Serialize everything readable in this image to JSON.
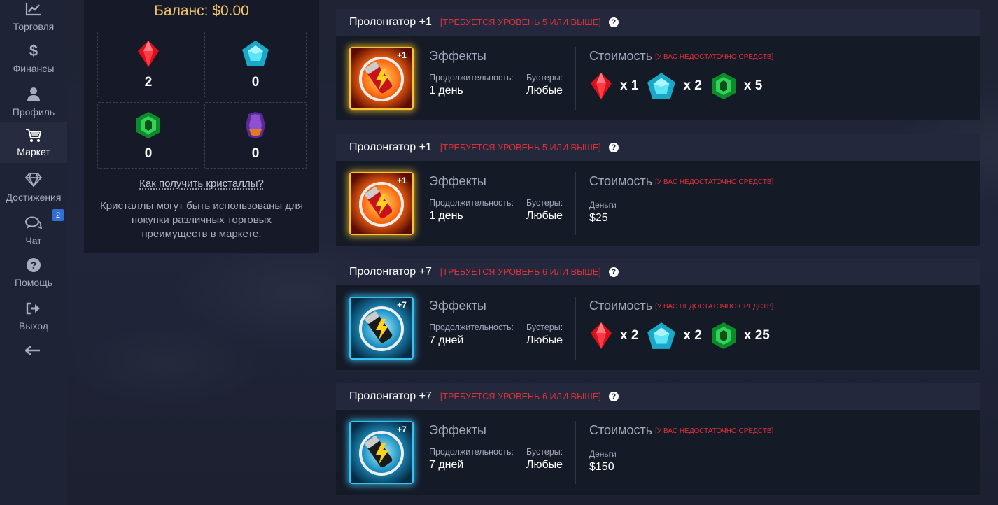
{
  "nav": {
    "items": [
      {
        "label": "Торговля",
        "icon": "chart-icon"
      },
      {
        "label": "Финансы",
        "icon": "dollar-icon"
      },
      {
        "label": "Профиль",
        "icon": "user-icon"
      },
      {
        "label": "Маркет",
        "icon": "cart-icon"
      },
      {
        "label": "Достижения",
        "icon": "diamond-icon"
      },
      {
        "label": "Чат",
        "icon": "chat-icon"
      },
      {
        "label": "Помощь",
        "icon": "help-icon"
      },
      {
        "label": "Выход",
        "icon": "logout-icon"
      }
    ],
    "chat_badge": "2",
    "active": "Маркет"
  },
  "balance": {
    "title": "Баланс: $0.00",
    "crystals": [
      {
        "name": "red",
        "count": "2"
      },
      {
        "name": "blue",
        "count": "0"
      },
      {
        "name": "green",
        "count": "0"
      },
      {
        "name": "purple",
        "count": "0"
      }
    ],
    "how_link": "Как получить кристаллы?",
    "description": "Кристаллы могут быть использованы для покупки различных торговых преимуществ в маркете."
  },
  "market": {
    "labels": {
      "effects": "Эффекты",
      "duration": "Продолжительность:",
      "boosters": "Бустеры:",
      "cost": "Стоимость",
      "insufficient": "[У ВАС НЕДОСТАТОЧНО СРЕДСТВ]",
      "money": "Деньги"
    },
    "items": [
      {
        "title": "Пролонгатор +1",
        "requirement": "[ТРЕБУЕТСЯ УРОВЕНЬ 5 ИЛИ ВЫШЕ]",
        "duration": "1 день",
        "boosters": "Любые",
        "image": "prolongator-plus-1",
        "price": {
          "red": "x 1",
          "blue": "x 2",
          "green": "x 5"
        }
      },
      {
        "title": "Пролонгатор +1",
        "requirement": "[ТРЕБУЕТСЯ УРОВЕНЬ 5 ИЛИ ВЫШЕ]",
        "duration": "1 день",
        "boosters": "Любые",
        "image": "prolongator-plus-1",
        "money": "$25"
      },
      {
        "title": "Пролонгатор +7",
        "requirement": "[ТРЕБУЕТСЯ УРОВЕНЬ 6 ИЛИ ВЫШЕ]",
        "duration": "7 дней",
        "boosters": "Любые",
        "image": "prolongator-plus-7",
        "price": {
          "red": "x 2",
          "blue": "x 2",
          "green": "x 25"
        }
      },
      {
        "title": "Пролонгатор +7",
        "requirement": "[ТРЕБУЕТСЯ УРОВЕНЬ 6 ИЛИ ВЫШЕ]",
        "duration": "7 дней",
        "boosters": "Любые",
        "image": "prolongator-plus-7",
        "money": "$150"
      }
    ],
    "badges": [
      "+1",
      "+7"
    ]
  },
  "colors": {
    "accent_red": "#e0313b",
    "balance_gold": "#f2c46a",
    "badge_blue": "#2f6fd6"
  }
}
